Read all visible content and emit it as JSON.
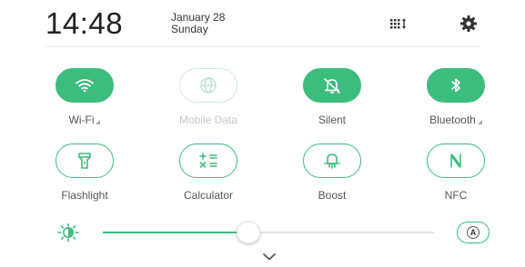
{
  "header": {
    "time": "14:48",
    "date": "January 28",
    "weekday": "Sunday",
    "edit_icon": "grid-sort-icon",
    "settings_icon": "gear-icon"
  },
  "tiles": [
    {
      "label": "Wi-Fi",
      "icon": "wifi-icon",
      "state": "on",
      "has_more": true
    },
    {
      "label": "Mobile Data",
      "icon": "globe-icon",
      "state": "disabled",
      "has_more": false
    },
    {
      "label": "Silent",
      "icon": "bell-off-icon",
      "state": "on",
      "has_more": false
    },
    {
      "label": "Bluetooth",
      "icon": "bluetooth-icon",
      "state": "on",
      "has_more": true
    },
    {
      "label": "Flashlight",
      "icon": "flashlight-icon",
      "state": "off",
      "has_more": false
    },
    {
      "label": "Calculator",
      "icon": "calculator-icon",
      "state": "off",
      "has_more": false
    },
    {
      "label": "Boost",
      "icon": "boost-icon",
      "state": "off",
      "has_more": false
    },
    {
      "label": "NFC",
      "icon": "nfc-icon",
      "state": "off",
      "has_more": false
    }
  ],
  "brightness": {
    "icon": "sun-icon",
    "level": 0.44,
    "auto_label": "A"
  },
  "colors": {
    "accent": "#3dbd7d",
    "accent_light": "#cfe9da",
    "text": "#555555",
    "disabled_text": "#c8c8c8"
  },
  "footer": {
    "collapse_icon": "chevron-down-icon"
  }
}
